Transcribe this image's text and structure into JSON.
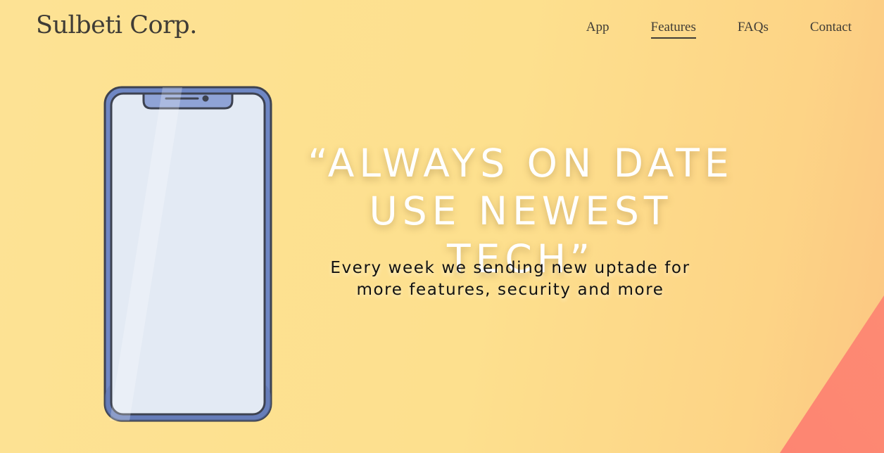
{
  "brand": {
    "name": "Sulbeti Corp."
  },
  "nav": {
    "items": [
      {
        "label": "App",
        "active": false
      },
      {
        "label": "Features",
        "active": true
      },
      {
        "label": "FAQs",
        "active": false
      },
      {
        "label": "Contact",
        "active": false
      }
    ]
  },
  "hero": {
    "headline_line1": "“ALWAYS ON DATE",
    "headline_line2": "USE NEWEST TECH”",
    "subtext": "Every week we sending new uptade for more features, security and more",
    "illustration": "smartphone-icon"
  },
  "colors": {
    "background": "#fde294",
    "corner_accent": "#fd8a73",
    "phone_frame": "#6f87c4",
    "phone_screen": "#e3eaf4",
    "text_dark": "#3f3c36"
  }
}
